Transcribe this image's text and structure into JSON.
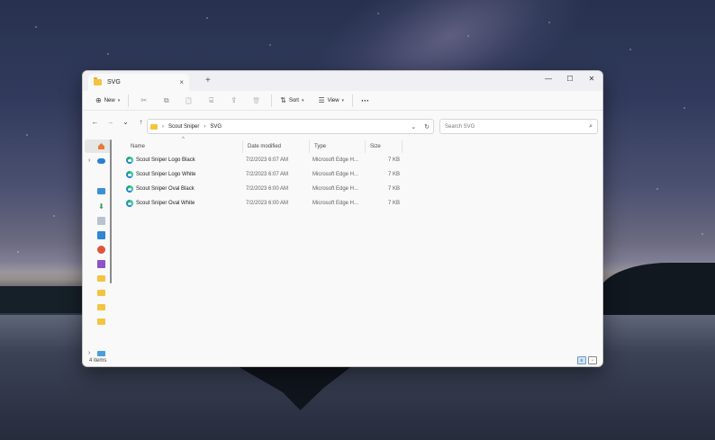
{
  "window": {
    "tab_title": "SVG",
    "tab_close_icon": "×",
    "new_tab_icon": "+",
    "controls": {
      "minimize": "—",
      "maximize": "☐",
      "close": "✕"
    }
  },
  "toolbar": {
    "new_label": "New",
    "sort_label": "Sort",
    "view_label": "View",
    "more_label": "···",
    "cut_icon": "✂",
    "copy_icon": "⧉",
    "paste_icon": "📋",
    "rename_icon": "⌸",
    "share_icon": "⇪",
    "delete_icon": "🗑"
  },
  "address": {
    "back": "←",
    "forward": "→",
    "recent": "⌄",
    "up": "↑",
    "crumbs": [
      "Scout Sniper",
      "SVG"
    ],
    "chevron": "›",
    "dropdown": "⌄",
    "refresh": "↻"
  },
  "search": {
    "placeholder": "Search SVG",
    "icon": "⌕"
  },
  "columns": {
    "name": "Name",
    "date": "Date modified",
    "type": "Type",
    "size": "Size",
    "sort_indicator": "^"
  },
  "files": [
    {
      "name": "Scout Sniper Logo Black",
      "date": "7/2/2023 6:07 AM",
      "type": "Microsoft Edge H...",
      "size": "7 KB"
    },
    {
      "name": "Scout Sniper Logo White",
      "date": "7/2/2023 6:07 AM",
      "type": "Microsoft Edge H...",
      "size": "7 KB"
    },
    {
      "name": "Scout Sniper Oval Black",
      "date": "7/2/2023 6:00 AM",
      "type": "Microsoft Edge H...",
      "size": "7 KB"
    },
    {
      "name": "Scout Sniper Oval White",
      "date": "7/2/2023 6:00 AM",
      "type": "Microsoft Edge H...",
      "size": "7 KB"
    }
  ],
  "status": {
    "item_count": "4 items"
  },
  "navpane_icons": [
    "home-icon",
    "onedrive-icon",
    "desktop-icon",
    "downloads-icon",
    "documents-icon",
    "pictures-icon",
    "music-icon",
    "videos-icon",
    "folder-icon",
    "folder-icon",
    "folder-icon",
    "folder-icon",
    "this-pc-icon"
  ],
  "colors": {
    "accent": "#0067c0",
    "folder": "#f5c342",
    "selection": "#e6e6e6"
  }
}
